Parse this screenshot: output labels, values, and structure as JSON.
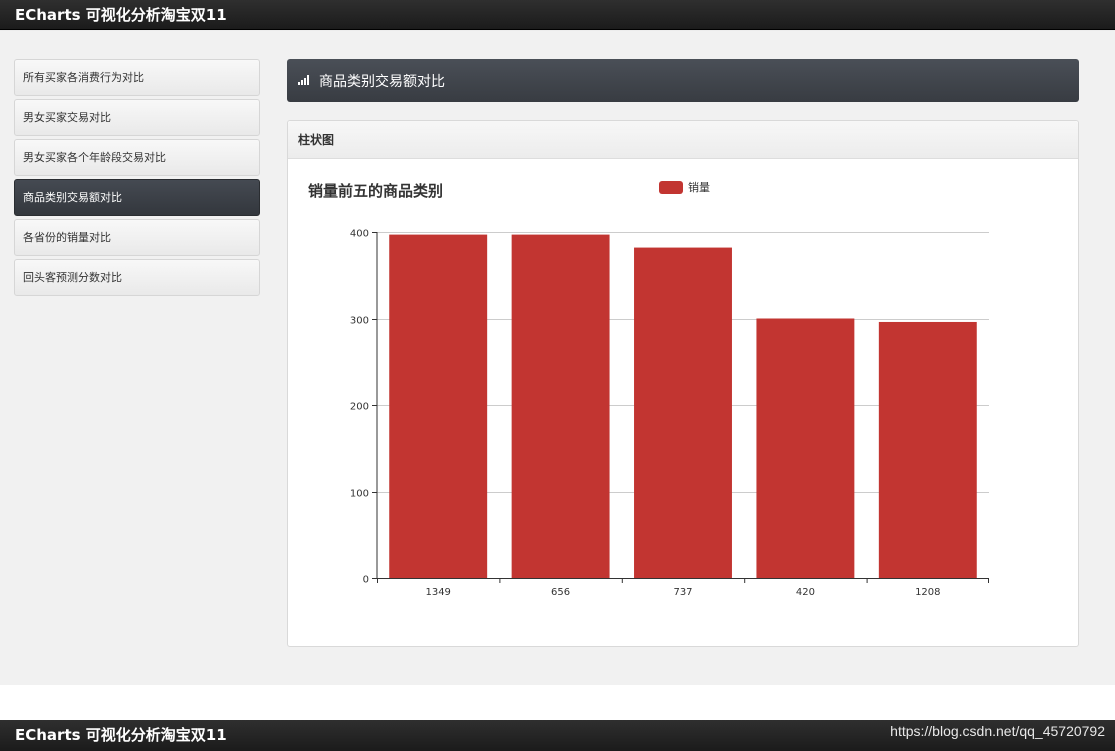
{
  "app": {
    "brand": "ECharts 可视化分析淘宝双11"
  },
  "sidebar": {
    "items": [
      {
        "label": "所有买家各消费行为对比"
      },
      {
        "label": "男女买家交易对比"
      },
      {
        "label": "男女买家各个年龄段交易对比"
      },
      {
        "label": "商品类别交易额对比",
        "active": true
      },
      {
        "label": "各省份的销量对比"
      },
      {
        "label": "回头客预测分数对比"
      }
    ]
  },
  "header": {
    "title": "商品类别交易额对比",
    "icon": "signal-bars-icon"
  },
  "panel": {
    "title": "柱状图"
  },
  "chart_data": {
    "type": "bar",
    "title": "销量前五的商品类别",
    "categories": [
      "1349",
      "656",
      "737",
      "420",
      "1208"
    ],
    "series": [
      {
        "name": "销量",
        "values": [
          397,
          397,
          382,
          300,
          296
        ],
        "color": "#c23531"
      }
    ],
    "ylim": [
      0,
      400
    ],
    "yticks": [
      0,
      100,
      200,
      300,
      400
    ],
    "xlabel": "",
    "ylabel": "",
    "grid": true,
    "legend": "top-center"
  },
  "footer": {
    "brand": "ECharts 可视化分析淘宝双11",
    "watermark": "https://blog.csdn.net/qq_45720792"
  }
}
